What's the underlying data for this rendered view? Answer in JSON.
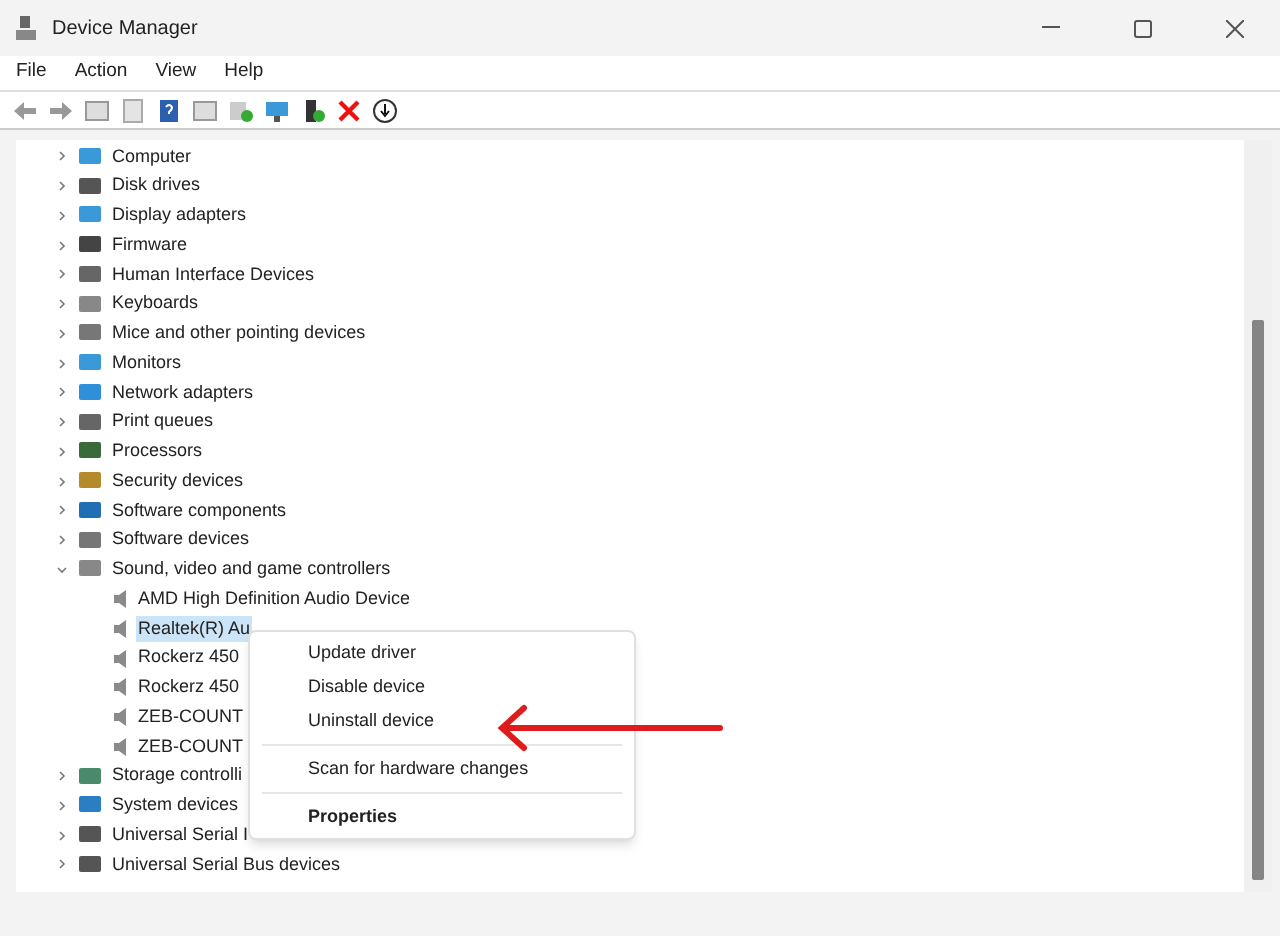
{
  "window": {
    "title": "Device Manager"
  },
  "menu_bar": [
    "File",
    "Action",
    "View",
    "Help"
  ],
  "tree": [
    {
      "label": "Computer",
      "expanded": false
    },
    {
      "label": "Disk drives",
      "expanded": false
    },
    {
      "label": "Display adapters",
      "expanded": false
    },
    {
      "label": "Firmware",
      "expanded": false
    },
    {
      "label": "Human Interface Devices",
      "expanded": false
    },
    {
      "label": "Keyboards",
      "expanded": false
    },
    {
      "label": "Mice and other pointing devices",
      "expanded": false
    },
    {
      "label": "Monitors",
      "expanded": false
    },
    {
      "label": "Network adapters",
      "expanded": false
    },
    {
      "label": "Print queues",
      "expanded": false
    },
    {
      "label": "Processors",
      "expanded": false
    },
    {
      "label": "Security devices",
      "expanded": false
    },
    {
      "label": "Software components",
      "expanded": false
    },
    {
      "label": "Software devices",
      "expanded": false
    },
    {
      "label": "Sound, video and game controllers",
      "expanded": true,
      "children": [
        {
          "label": "AMD High Definition Audio Device",
          "selected": false
        },
        {
          "label": "Realtek(R) Au",
          "selected": true
        },
        {
          "label": "Rockerz 450",
          "selected": false
        },
        {
          "label": "Rockerz 450",
          "selected": false
        },
        {
          "label": "ZEB-COUNT",
          "selected": false
        },
        {
          "label": "ZEB-COUNT",
          "selected": false
        }
      ]
    },
    {
      "label": "Storage controlli",
      "expanded": false
    },
    {
      "label": "System devices",
      "expanded": false
    },
    {
      "label": "Universal Serial I",
      "expanded": false
    },
    {
      "label": "Universal Serial Bus devices",
      "expanded": false
    }
  ],
  "context_menu": [
    {
      "label": "Update driver",
      "separator_before": false,
      "default": false
    },
    {
      "label": "Disable device",
      "separator_before": false,
      "default": false
    },
    {
      "label": "Uninstall device",
      "separator_before": false,
      "default": false
    },
    {
      "label": "Scan for hardware changes",
      "separator_before": true,
      "default": false
    },
    {
      "label": "Properties",
      "separator_before": true,
      "default": true
    }
  ]
}
